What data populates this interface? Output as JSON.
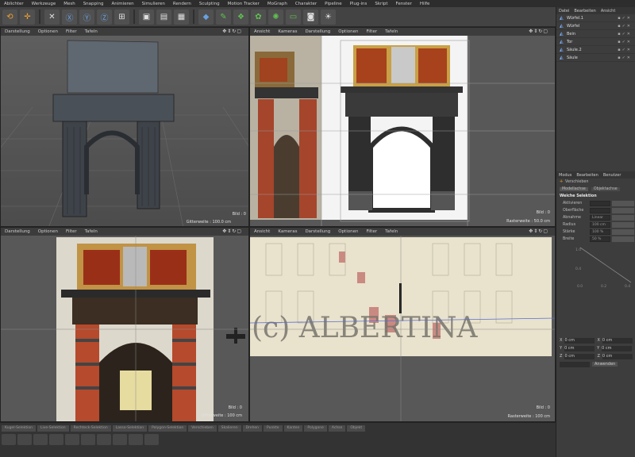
{
  "menu": [
    "Ablichter",
    "Werkzeuge",
    "Mesh",
    "Snapping",
    "Animieren",
    "Simulieren",
    "Rendern",
    "Sculpting",
    "Motion Tracker",
    "MoGraph",
    "Charakter",
    "Pipeline",
    "Plug-ins",
    "Skript",
    "Fenster",
    "Hilfe"
  ],
  "viewports": {
    "tl": {
      "menu": [
        "Darstellung",
        "Optionen",
        "Filter",
        "Tafeln"
      ],
      "footer": "Gitterweite : 100.0 cm",
      "tag": "Bild : 0"
    },
    "tr": {
      "menu": [
        "Ansicht",
        "Kameras",
        "Darstellung",
        "Optionen",
        "Filter",
        "Tafeln"
      ],
      "footer": "Rasterweite : 50.0 cm",
      "tag": "Bild : 0"
    },
    "bl": {
      "menu": [
        "Darstellung",
        "Optionen",
        "Filter",
        "Tafeln"
      ],
      "footer": "Gitterweite : 100 cm",
      "tag": "Bild : 0"
    },
    "br": {
      "menu": [
        "Ansicht",
        "Kameras",
        "Darstellung",
        "Optionen",
        "Filter",
        "Tafeln"
      ],
      "footer": "Rasterweite : 100 cm",
      "tag": "Bild : 0",
      "watermark": "(c) ALBERTINA"
    }
  },
  "objects_panel": {
    "tabs": [
      "Datei",
      "Bearbeiten",
      "Ansicht"
    ],
    "items": [
      "Würfel.1",
      "Würfel",
      "Bein",
      "Tor",
      "Säule.2",
      "Säule"
    ]
  },
  "attributes_panel": {
    "tabs": [
      "Modus",
      "Bearbeiten",
      "Benutzer"
    ],
    "mode": "Verschieben",
    "subtabs": [
      "Modellachse",
      "Objektachse"
    ],
    "section": "Weiche Selektion",
    "rows": [
      {
        "label": "Aktivieren",
        "value": ""
      },
      {
        "label": "Oberfläche",
        "value": ""
      },
      {
        "label": "Abnahme",
        "value": "Linear"
      },
      {
        "label": "Radius",
        "value": "100 cm"
      },
      {
        "label": "Stärke",
        "value": "100 %"
      },
      {
        "label": "Breite",
        "value": "50 %"
      }
    ],
    "graph_labels": [
      "1.0",
      "0.8",
      "0.4",
      "0.0",
      "0.2",
      "0.4"
    ]
  },
  "coords": {
    "rows": [
      {
        "axis": "X",
        "v1": "0 cm",
        "axis2": "X",
        "v2": "0 cm"
      },
      {
        "axis": "Y",
        "v1": "0 cm",
        "axis2": "Y",
        "v2": "0 cm"
      },
      {
        "axis": "Z",
        "v1": "0 cm",
        "axis2": "Z",
        "v2": "0 cm"
      }
    ],
    "apply": "Anwenden"
  },
  "bottom_tabs": [
    "Kugel-Selektion",
    "Live-Selektion",
    "Rechteck-Selektion",
    "Lasso-Selektion",
    "Polygon-Selektion",
    "Verschieben",
    "Skalieren",
    "Drehen",
    "Punkte",
    "Kanten",
    "Polygone",
    "Achse",
    "Objekt"
  ],
  "colors": {
    "accent": "#f0a030",
    "panel": "#3d3d3d"
  }
}
